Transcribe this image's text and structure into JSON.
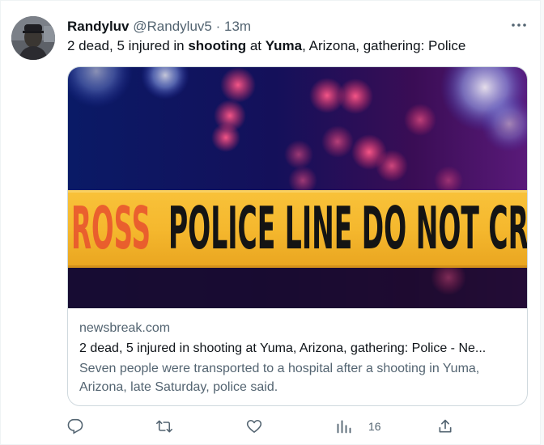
{
  "colors": {
    "text_primary": "#0f1419",
    "text_secondary": "#536471",
    "tape_yellow": "#f5b82e",
    "tape_text": "#141414",
    "tape_faded_text": "#e8502e"
  },
  "tweet": {
    "author_name": "Randyluv",
    "author_handle": "@Randyluv5",
    "separator": "·",
    "time": "13m",
    "text": {
      "part1": "2 dead, 5 injured in ",
      "bold1": "shooting",
      "part2": " at ",
      "bold2": "Yuma",
      "part3": ", Arizona, gathering: Police"
    }
  },
  "card": {
    "image": {
      "tape_text_faded": "ROSS",
      "tape_text": "POLICE LINE DO NOT CR"
    },
    "domain": "newsbreak.com",
    "title": "2 dead, 5 injured in shooting at Yuma, Arizona, gathering: Police - Ne...",
    "description": "Seven people were transported to a hospital after a shooting in Yuma, Arizona, late Saturday, police said."
  },
  "actions": {
    "reply_icon": "reply-icon",
    "retweet_icon": "retweet-icon",
    "like_icon": "heart-icon",
    "views_icon": "views-chart-icon",
    "views_count": "16",
    "share_icon": "share-icon",
    "more_icon": "more-dots-icon"
  }
}
